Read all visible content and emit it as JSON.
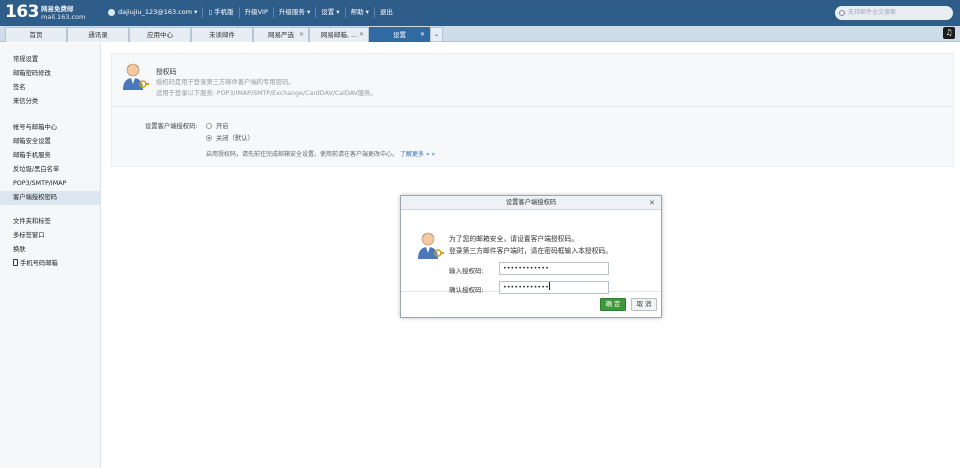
{
  "header": {
    "logo_big": "163",
    "logo_line1": "网易免费邮",
    "logo_line2": "mail.163.com",
    "account": "dajiujiu_123@163.com",
    "nav": [
      "手机版",
      "升级VIP",
      "升级服务",
      "设置",
      "帮助",
      "退出"
    ],
    "search_placeholder": "支持邮件全文搜索"
  },
  "tabs": [
    {
      "label": "首页"
    },
    {
      "label": "通讯录"
    },
    {
      "label": "应用中心"
    },
    {
      "label": "未读邮件"
    },
    {
      "label": "网易严选"
    },
    {
      "label": "网易邮箱, ..."
    },
    {
      "label": "设置"
    }
  ],
  "sidebar": {
    "group1": [
      "常规设置",
      "邮箱密码修改",
      "签名",
      "来信分类"
    ],
    "group2": [
      "帐号与邮箱中心",
      "邮箱安全设置",
      "邮箱手机服务",
      "反垃圾/黑白名单",
      "POP3/SMTP/IMAP",
      "客户端授权密码"
    ],
    "group3": [
      "文件夹和标签",
      "多标签窗口",
      "换肤",
      "手机号码邮箱"
    ]
  },
  "panel": {
    "title": "授权码",
    "desc1": "授权码是用于登录第三方邮件客户端的专用密码。",
    "desc2": "适用于登录以下服务: POP3/IMAP/SMTP/Exchange/CardDAV/CalDAV服务。",
    "setting_label": "设置客户端授权码:",
    "option_on": "开启",
    "option_off": "关闭（默认）",
    "note": "启用授权码，请先前往完成邮箱安全设置。使用前请在客户端更改中心。",
    "learn_more": "了解更多 » »"
  },
  "dialog": {
    "title": "设置客户端授权码",
    "msg1": "为了您的邮箱安全，请设置客户端授权码。",
    "msg2": "登录第三方邮件客户端时，请在密码框输入本授权码。",
    "label1": "输入授权码:",
    "value1": "••••••••••••",
    "label2": "确认授权码:",
    "value2": "••••••••••••",
    "ok": "确 定",
    "cancel": "取 消"
  }
}
